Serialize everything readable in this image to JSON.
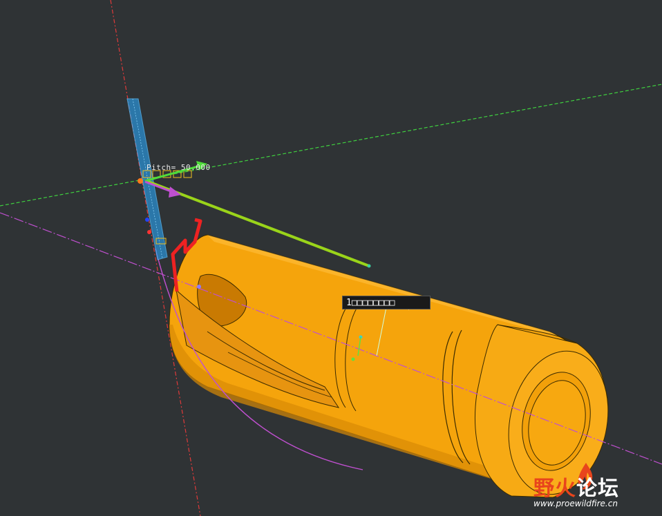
{
  "viewport": {
    "background": "#2f3335",
    "model_color": "#f5a40c",
    "pitch_label": "Pitch= 50.000",
    "dimension_tag": "1□□□□□□□□",
    "axis_colors": {
      "vertical_red_dashed": "#e03a3a",
      "green_dashed": "#3fd13f",
      "magenta_line": "#c050d0",
      "blue_plane": "#3aa0e0",
      "sketch_red": "#ee2222",
      "vector_green": "#9ad41a"
    }
  },
  "watermark": {
    "title_part1": "野火",
    "title_part2": "论坛",
    "url": "www.proewildfire.cn",
    "icons": [
      "flame-logo-icon"
    ]
  }
}
